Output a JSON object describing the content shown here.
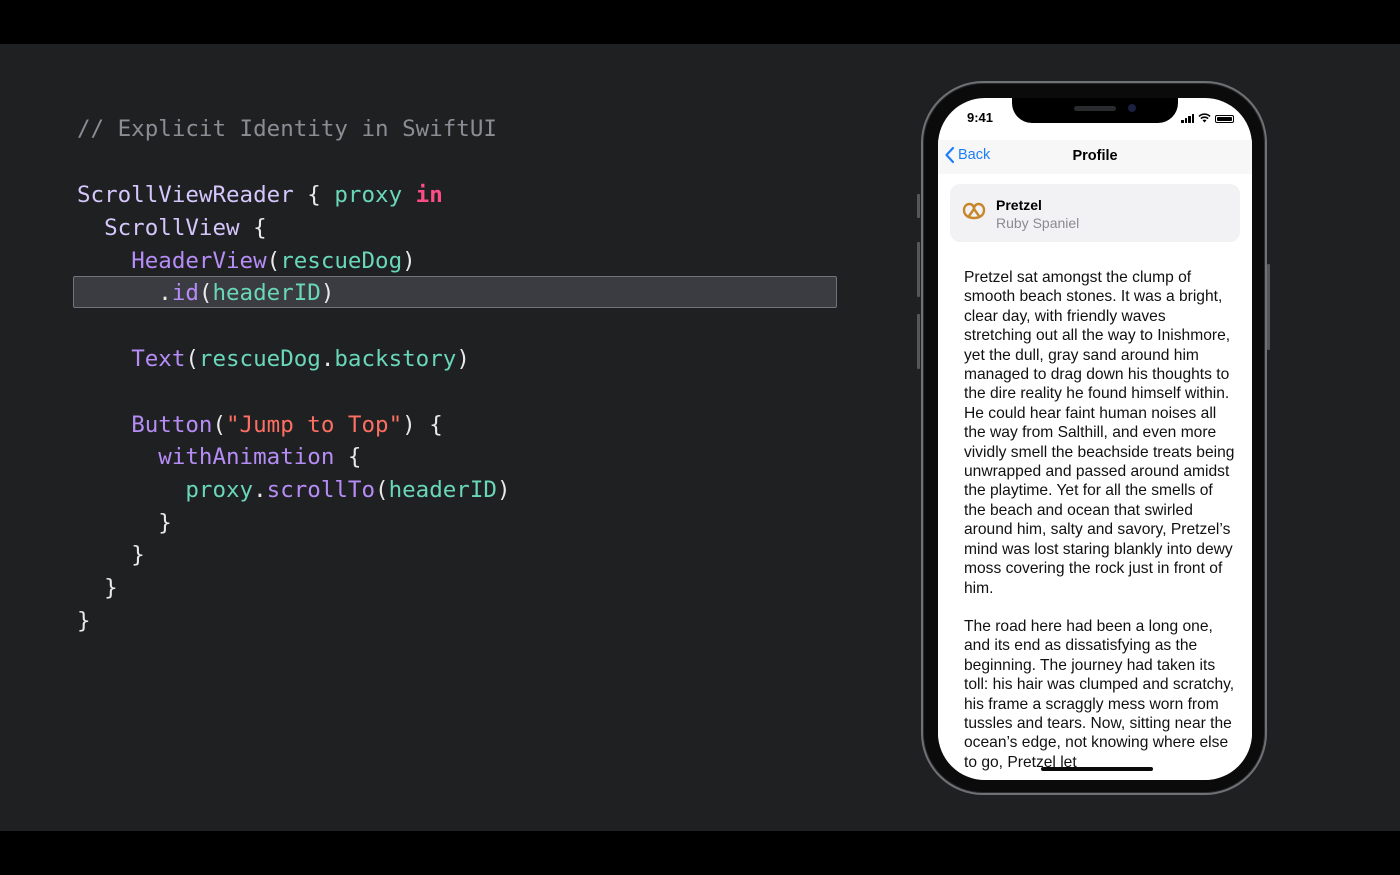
{
  "code": {
    "comment": "// Explicit Identity in SwiftUI",
    "l1": {
      "type": "ScrollViewReader",
      "brace": " { ",
      "param": "proxy",
      "kw": "in"
    },
    "l2": {
      "type": "ScrollView",
      "brace": " {"
    },
    "l3": {
      "fn": "HeaderView",
      "open": "(",
      "arg": "rescueDog",
      "close": ")"
    },
    "l4": {
      "dot": ".",
      "fn": "id",
      "open": "(",
      "arg": "headerID",
      "close": ")"
    },
    "l5": {
      "fn": "Text",
      "open": "(",
      "arg1": "rescueDog",
      "dot": ".",
      "arg2": "backstory",
      "close": ")"
    },
    "l6": {
      "fn": "Button",
      "open": "(",
      "str": "\"Jump to Top\"",
      "close": ") {"
    },
    "l7": {
      "fn": "withAnimation",
      "brace": " {"
    },
    "l8": {
      "var": "proxy",
      "dot": ".",
      "fn": "scrollTo",
      "open": "(",
      "arg": "headerID",
      "close": ")"
    },
    "close_brace": "}"
  },
  "phone": {
    "status_time": "9:41",
    "nav": {
      "back_label": "Back",
      "title": "Profile"
    },
    "card": {
      "icon": "pretzel-icon",
      "name": "Pretzel",
      "breed": "Ruby Spaniel"
    },
    "story_paragraphs": [
      "Pretzel sat amongst the clump of smooth beach stones. It was a bright, clear day, with friendly waves stretching out all the way to Inishmore, yet the dull, gray sand around him managed to drag down his thoughts to the dire reality he found himself within. He could hear faint human noises all the way from Salthill, and even more vividly smell the beachside treats being unwrapped and passed around amidst the playtime. Yet for all the smells of the beach and ocean that swirled around him, salty and savory, Pretzel’s mind was lost staring blankly into dewy moss covering the rock just in front of him.",
      "The road here had been a long one, and its end as dissatisfying as the beginning. The journey had taken its toll: his hair was clumped and scratchy, his frame a scraggly mess worn from tussles and tears. Now, sitting near the ocean’s edge, not knowing where else to go, Pretzel let"
    ]
  },
  "colors": {
    "background": "#1f2022",
    "comment": "#8a8d93",
    "type": "#d5c6fb",
    "function": "#b68cf7",
    "variable": "#69d7b8",
    "keyword": "#fd4d86",
    "string": "#fd6f62",
    "ios_blue": "#1d7ef8"
  }
}
